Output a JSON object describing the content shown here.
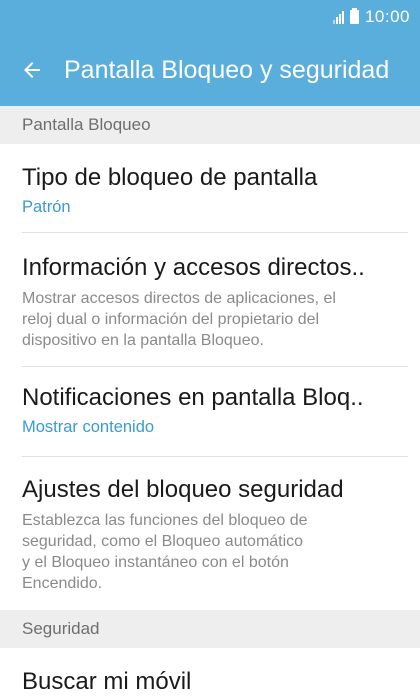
{
  "status_bar": {
    "time": "10:00",
    "signal_icon": "signal-icon",
    "battery_icon": "battery-icon"
  },
  "app_bar": {
    "title": "Pantalla Bloqueo y seguridad",
    "back_icon": "arrow-back-icon"
  },
  "sections": [
    {
      "header": "Pantalla Bloqueo"
    },
    {
      "header": "Seguridad"
    }
  ],
  "items": [
    {
      "title": "Tipo de bloqueo de pantalla",
      "subtitle": "Patrón"
    },
    {
      "title": "Información y accesos directos..",
      "subtitle": "Mostrar accesos directos de aplicaciones, el\nreloj dual o información del propietario del\ndispositivo en la pantalla Bloqueo."
    },
    {
      "title": "Notificaciones en pantalla Bloq..",
      "subtitle": "Mostrar contenido"
    },
    {
      "title": "Ajustes del bloqueo seguridad",
      "subtitle": "Establezca las funciones del bloqueo de\nseguridad, como el Bloqueo automático\ny el Bloqueo instantáneo con el botón\nEncendido."
    },
    {
      "title": "Buscar mi móvil"
    }
  ],
  "colors": {
    "accent": "#5aaedc",
    "link": "#3a9ad6",
    "section_bg": "#eeeeee"
  }
}
